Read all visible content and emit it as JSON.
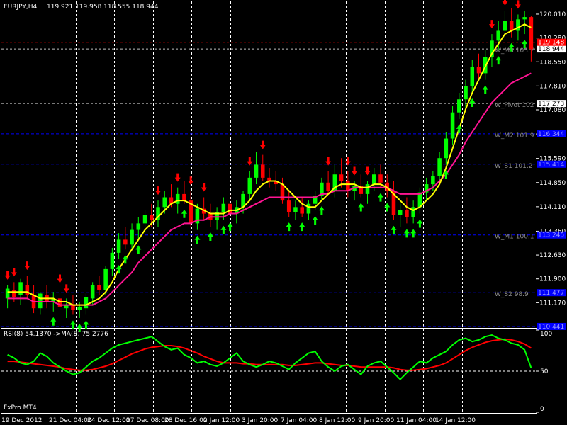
{
  "window": {
    "symbol_label": "EURJPY,H4",
    "ohlc": "119.921 119.958 118.555 118.944",
    "footer": "FxPro MT4"
  },
  "rsi_panel": {
    "label": "RSI(8) 54.1370   ->MA(8) 75.2776",
    "ticks": [
      {
        "label": "100",
        "v": 100
      },
      {
        "label": "50",
        "v": 50
      },
      {
        "label": "0",
        "v": 0
      }
    ]
  },
  "colors": {
    "background": "#000000",
    "bull": "#00ff00",
    "bear": "#ff0000",
    "ma_fast": "#ffff00",
    "ma_slow": "#ff1493",
    "rsi": "#00ff00",
    "rsi_ma": "#ff0000",
    "grid": "#ffffff",
    "level_line": "#0000ff",
    "pivot_line": "#c0c0c0"
  },
  "chart_data": {
    "type": "candlestick",
    "timeframe": "H4",
    "symbol": "EURJPY",
    "grid": true,
    "ylim": [
      110.44,
      120.4
    ],
    "y_ticks": [
      120.01,
      119.28,
      118.55,
      117.81,
      117.08,
      116.34,
      115.59,
      114.85,
      114.11,
      113.36,
      112.63,
      111.9,
      111.17
    ],
    "x_ticks": [
      "19 Dec 2012",
      "21 Dec 04:00",
      "24 Dec 12:00",
      "27 Dec 08:00",
      "28 Dec 16:00",
      "2 Jan 12:00",
      "3 Jan 20:00",
      "7 Jan 04:00",
      "8 Jan 12:00",
      "9 Jan 20:00",
      "11 Jan 04:00",
      "14 Jan 12:00"
    ],
    "current_price": "118.944",
    "bid_tag": "119.148",
    "pivot_tag": "117.273",
    "levels": [
      {
        "name": "W_M3 103.7",
        "tag": "118.944",
        "value": 118.944,
        "style": "pivot"
      },
      {
        "name": "W_Pivot 102",
        "tag": "117.273",
        "value": 117.273,
        "style": "pivot"
      },
      {
        "name": "W_M2 101.9",
        "tag": "116.344",
        "value": 116.344,
        "style": "blue"
      },
      {
        "name": "W_S1 101.2",
        "tag": "115.414",
        "value": 115.414,
        "style": "blue"
      },
      {
        "name": "W_M1 100.1",
        "tag": "113.245",
        "value": 113.245,
        "style": "blue"
      },
      {
        "name": "W_S2 98.9",
        "tag": "111.477",
        "value": 111.477,
        "style": "blue"
      },
      {
        "name": "",
        "tag": "110.441",
        "value": 110.441,
        "style": "blue"
      }
    ],
    "candles": [
      [
        111.3,
        111.7,
        111.0,
        111.6
      ],
      [
        111.55,
        111.8,
        111.2,
        111.35
      ],
      [
        111.4,
        111.9,
        111.1,
        111.8
      ],
      [
        111.7,
        112.0,
        111.3,
        111.4
      ],
      [
        111.4,
        111.7,
        110.85,
        111.0
      ],
      [
        111.0,
        111.5,
        110.8,
        111.45
      ],
      [
        111.4,
        111.7,
        111.0,
        111.2
      ],
      [
        111.2,
        111.5,
        110.9,
        111.3
      ],
      [
        111.3,
        111.6,
        110.95,
        111.05
      ],
      [
        111.0,
        111.3,
        110.7,
        111.1
      ],
      [
        111.1,
        111.4,
        110.8,
        110.95
      ],
      [
        110.95,
        111.2,
        110.7,
        111.05
      ],
      [
        111.0,
        111.45,
        110.8,
        111.35
      ],
      [
        111.3,
        111.8,
        111.1,
        111.7
      ],
      [
        111.7,
        112.0,
        111.4,
        111.55
      ],
      [
        111.55,
        112.3,
        111.4,
        112.2
      ],
      [
        112.2,
        112.85,
        112.0,
        112.7
      ],
      [
        112.7,
        113.3,
        112.5,
        113.1
      ],
      [
        113.1,
        113.5,
        112.8,
        112.95
      ],
      [
        112.95,
        113.6,
        112.8,
        113.4
      ],
      [
        113.4,
        113.8,
        113.1,
        113.6
      ],
      [
        113.6,
        114.0,
        113.3,
        113.85
      ],
      [
        113.85,
        114.2,
        113.5,
        113.7
      ],
      [
        113.7,
        114.3,
        113.5,
        114.1
      ],
      [
        114.1,
        114.6,
        113.9,
        114.4
      ],
      [
        114.4,
        114.8,
        114.1,
        114.2
      ],
      [
        114.2,
        114.7,
        113.9,
        114.5
      ],
      [
        114.5,
        114.9,
        114.2,
        114.3
      ],
      [
        114.3,
        114.6,
        113.5,
        113.6
      ],
      [
        113.6,
        114.2,
        113.4,
        114.05
      ],
      [
        114.05,
        114.4,
        113.7,
        113.9
      ],
      [
        113.9,
        114.2,
        113.5,
        113.7
      ],
      [
        113.7,
        114.1,
        113.4,
        113.95
      ],
      [
        113.95,
        114.4,
        113.7,
        114.2
      ],
      [
        114.2,
        114.5,
        113.8,
        113.9
      ],
      [
        113.9,
        114.3,
        113.6,
        114.1
      ],
      [
        114.1,
        114.6,
        113.9,
        114.5
      ],
      [
        114.5,
        115.2,
        114.3,
        115.0
      ],
      [
        115.0,
        115.8,
        114.8,
        115.4
      ],
      [
        115.4,
        115.7,
        114.9,
        115.0
      ],
      [
        115.0,
        115.3,
        114.7,
        114.9
      ],
      [
        114.9,
        115.2,
        114.6,
        114.8
      ],
      [
        114.8,
        115.0,
        114.2,
        114.3
      ],
      [
        114.3,
        114.6,
        113.8,
        113.95
      ],
      [
        113.95,
        114.3,
        113.7,
        114.1
      ],
      [
        114.1,
        114.4,
        113.8,
        113.9
      ],
      [
        113.9,
        114.3,
        113.7,
        114.2
      ],
      [
        114.2,
        114.6,
        114.0,
        114.45
      ],
      [
        114.45,
        115.0,
        114.3,
        114.85
      ],
      [
        114.85,
        115.2,
        114.5,
        114.6
      ],
      [
        114.6,
        115.4,
        114.4,
        115.1
      ],
      [
        115.1,
        115.6,
        114.7,
        114.9
      ],
      [
        114.9,
        115.2,
        114.4,
        114.6
      ],
      [
        114.6,
        114.9,
        114.3,
        114.75
      ],
      [
        114.75,
        115.1,
        114.4,
        114.5
      ],
      [
        114.5,
        114.9,
        114.2,
        114.8
      ],
      [
        114.8,
        115.3,
        114.6,
        115.1
      ],
      [
        115.1,
        115.4,
        114.7,
        114.85
      ],
      [
        114.85,
        115.1,
        114.4,
        114.6
      ],
      [
        114.6,
        114.9,
        113.7,
        113.85
      ],
      [
        113.85,
        114.2,
        113.5,
        114.0
      ],
      [
        114.0,
        114.4,
        113.6,
        113.8
      ],
      [
        113.8,
        114.3,
        113.6,
        114.1
      ],
      [
        114.1,
        114.7,
        113.9,
        114.55
      ],
      [
        114.55,
        115.0,
        114.3,
        114.8
      ],
      [
        114.8,
        115.2,
        114.6,
        115.05
      ],
      [
        115.05,
        115.8,
        114.9,
        115.6
      ],
      [
        115.6,
        116.4,
        115.4,
        116.2
      ],
      [
        116.2,
        117.2,
        116.0,
        117.0
      ],
      [
        117.0,
        117.6,
        116.8,
        117.4
      ],
      [
        117.4,
        118.0,
        117.1,
        117.8
      ],
      [
        117.8,
        118.6,
        117.6,
        118.4
      ],
      [
        118.4,
        118.8,
        118.0,
        118.2
      ],
      [
        118.2,
        118.9,
        118.0,
        118.7
      ],
      [
        118.7,
        119.4,
        118.4,
        119.2
      ],
      [
        119.2,
        119.8,
        118.9,
        119.5
      ],
      [
        119.5,
        120.1,
        119.2,
        119.8
      ],
      [
        119.8,
        120.2,
        119.3,
        119.5
      ],
      [
        119.5,
        120.0,
        119.2,
        119.85
      ],
      [
        119.85,
        120.1,
        119.4,
        119.92
      ],
      [
        119.92,
        119.96,
        118.56,
        118.94
      ]
    ],
    "ma_fast": [
      111.5,
      111.5,
      111.5,
      111.5,
      111.4,
      111.3,
      111.3,
      111.3,
      111.2,
      111.2,
      111.1,
      111.1,
      111.1,
      111.2,
      111.3,
      111.5,
      111.8,
      112.2,
      112.5,
      112.8,
      113.1,
      113.4,
      113.6,
      113.8,
      114.0,
      114.2,
      114.3,
      114.3,
      114.2,
      114.1,
      114.0,
      113.9,
      113.9,
      113.9,
      114.0,
      114.0,
      114.1,
      114.3,
      114.6,
      114.8,
      114.9,
      114.9,
      114.8,
      114.6,
      114.4,
      114.2,
      114.1,
      114.1,
      114.3,
      114.5,
      114.7,
      114.8,
      114.8,
      114.8,
      114.7,
      114.7,
      114.8,
      114.8,
      114.7,
      114.5,
      114.3,
      114.1,
      114.0,
      114.1,
      114.3,
      114.5,
      114.8,
      115.3,
      115.9,
      116.5,
      117.1,
      117.6,
      118.0,
      118.4,
      118.8,
      119.1,
      119.4,
      119.5,
      119.6,
      119.7,
      119.6
    ],
    "ma_slow": [
      111.3,
      111.3,
      111.3,
      111.3,
      111.2,
      111.2,
      111.2,
      111.2,
      111.1,
      111.1,
      111.1,
      111.1,
      111.1,
      111.1,
      111.2,
      111.3,
      111.5,
      111.7,
      111.9,
      112.1,
      112.4,
      112.6,
      112.8,
      113.0,
      113.2,
      113.4,
      113.5,
      113.6,
      113.6,
      113.7,
      113.7,
      113.8,
      113.8,
      113.8,
      113.9,
      113.9,
      114.0,
      114.1,
      114.2,
      114.3,
      114.4,
      114.4,
      114.4,
      114.4,
      114.4,
      114.4,
      114.4,
      114.4,
      114.5,
      114.5,
      114.6,
      114.6,
      114.6,
      114.7,
      114.7,
      114.7,
      114.7,
      114.7,
      114.7,
      114.6,
      114.5,
      114.5,
      114.5,
      114.5,
      114.6,
      114.7,
      114.9,
      115.1,
      115.4,
      115.7,
      116.1,
      116.4,
      116.7,
      117.0,
      117.3,
      117.5,
      117.7,
      117.9,
      118.0,
      118.1,
      118.2
    ],
    "up_arrows": [
      7,
      10,
      11,
      12,
      17,
      18,
      20,
      27,
      29,
      31,
      33,
      34,
      43,
      45,
      47,
      48,
      54,
      57,
      58,
      59,
      61,
      62,
      63,
      67,
      69,
      71,
      73,
      75,
      77,
      79
    ],
    "down_arrows": [
      0,
      1,
      3,
      8,
      9,
      23,
      26,
      28,
      30,
      37,
      39,
      49,
      52,
      53,
      55,
      74,
      76,
      78
    ],
    "rsi": {
      "values": [
        70,
        66,
        60,
        58,
        62,
        72,
        68,
        60,
        55,
        50,
        46,
        48,
        55,
        62,
        66,
        72,
        78,
        82,
        84,
        86,
        88,
        90,
        92,
        86,
        80,
        76,
        78,
        70,
        66,
        60,
        62,
        58,
        56,
        60,
        66,
        72,
        62,
        58,
        55,
        58,
        62,
        60,
        56,
        52,
        60,
        66,
        72,
        74,
        62,
        55,
        50,
        56,
        58,
        52,
        46,
        56,
        60,
        62,
        55,
        48,
        40,
        48,
        55,
        62,
        60,
        66,
        70,
        74,
        82,
        88,
        90,
        86,
        88,
        92,
        94,
        90,
        88,
        84,
        82,
        76,
        54
      ],
      "ma": [
        62,
        62,
        61,
        60,
        59,
        58,
        57,
        56,
        55,
        53,
        52,
        51,
        51,
        52,
        54,
        56,
        59,
        63,
        67,
        71,
        74,
        77,
        79,
        80,
        81,
        81,
        80,
        78,
        75,
        72,
        68,
        65,
        62,
        60,
        60,
        60,
        59,
        59,
        58,
        58,
        58,
        58,
        58,
        57,
        57,
        58,
        59,
        60,
        60,
        59,
        58,
        57,
        57,
        56,
        55,
        55,
        55,
        55,
        55,
        54,
        52,
        51,
        51,
        52,
        53,
        55,
        57,
        60,
        65,
        70,
        75,
        79,
        82,
        85,
        87,
        88,
        89,
        88,
        86,
        83,
        78
      ],
      "ylim": [
        0,
        100
      ]
    }
  }
}
